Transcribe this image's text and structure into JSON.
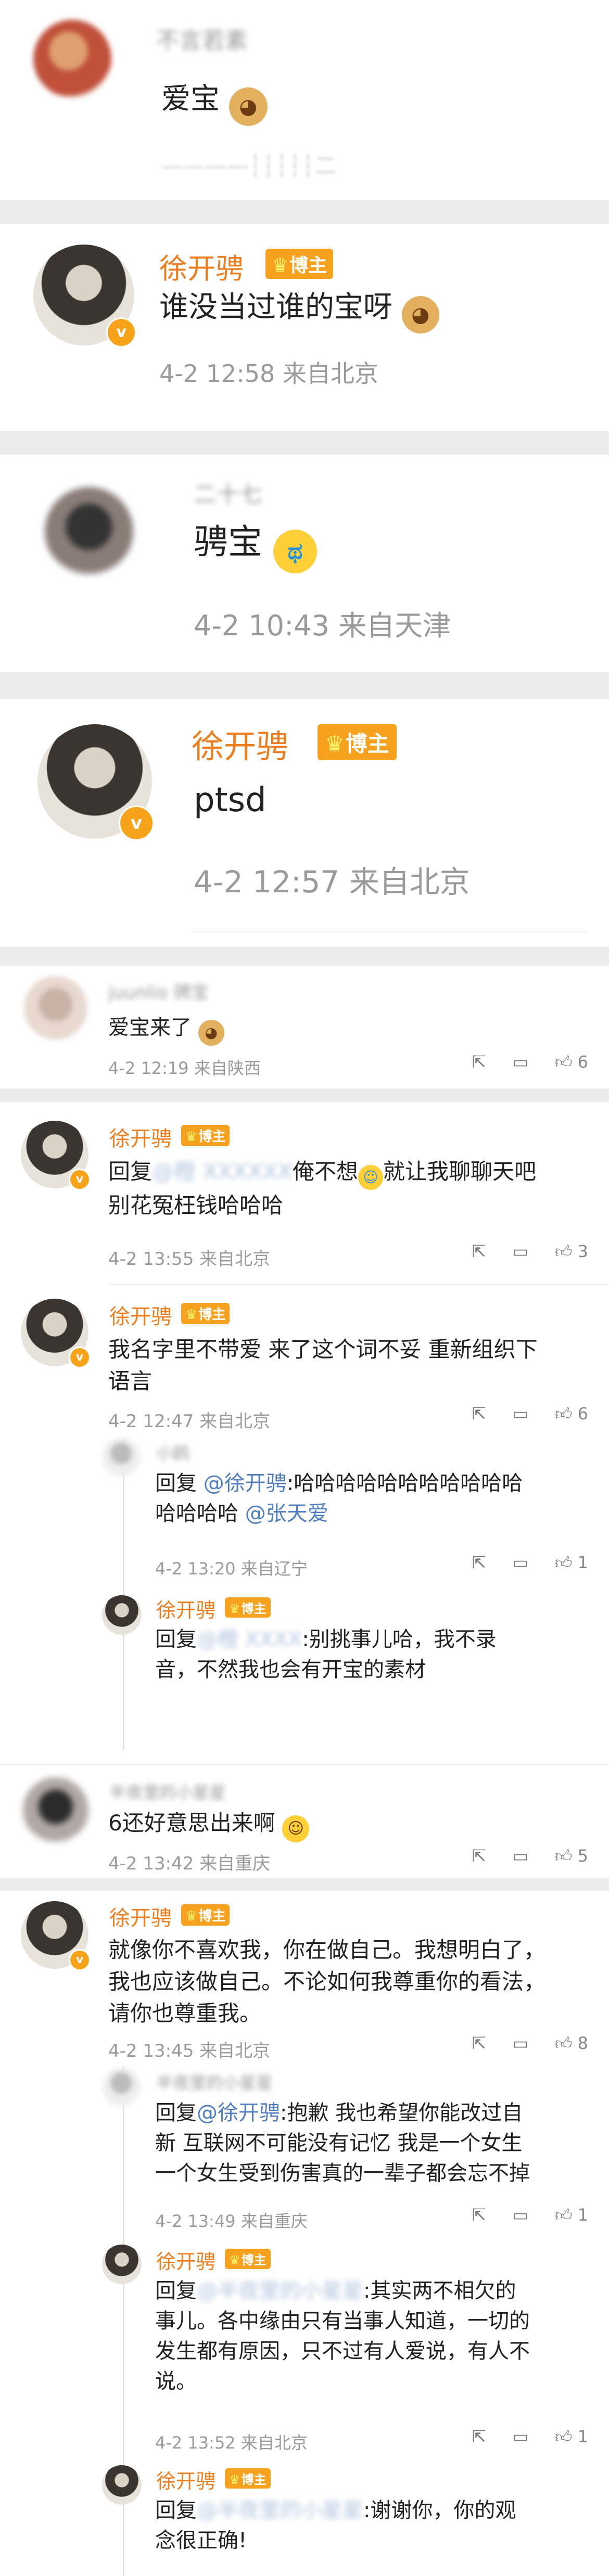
{
  "posts": {
    "p1": {
      "author": "不言若素",
      "text": "爱宝",
      "emoji": "doge-emoji",
      "extra": "————┆┆┆┆┆二"
    },
    "p2": {
      "author": "徐开骋",
      "badge": "博主",
      "text": "谁没当过谁的宝呀",
      "emoji": "doge-emoji",
      "meta": "4-2 12:58  来自北京"
    },
    "p3": {
      "author": "二十七",
      "text": "骋宝",
      "emoji": "cry-emoji",
      "meta": "4-2 10:43  来自天津"
    },
    "p4": {
      "author": "徐开骋",
      "badge": "博主",
      "text": "ptsd",
      "meta": "4-2 12:57  来自北京"
    }
  },
  "comments": {
    "c1": {
      "author": "juunlio 骋宝",
      "text": "爱宝来了",
      "meta": "4-2 12:19  来自陕西",
      "likes": "6"
    },
    "c2": {
      "author": "徐开骋",
      "badge": "博主",
      "reply_prefix": "回复",
      "reply_to_blur": "@橙 XXXXXX",
      "text_a": "俺不想",
      "text_b": "就让我聊聊天吧",
      "text_c": "别花冤枉钱哈哈哈",
      "meta": "4-2 13:55  来自北京",
      "likes": "3"
    },
    "c3": {
      "author": "徐开骋",
      "badge": "博主",
      "line1": "我名字里不带爱 来了这个词不妥 重新组织下",
      "line2": "语言",
      "meta": "4-2 12:47  来自北京",
      "likes": "6"
    },
    "c3r1": {
      "author": "小鸥",
      "reply_prefix": "回复",
      "mention1": "@徐开骋",
      "text1": ":哈哈哈哈哈哈哈哈哈哈哈",
      "line2": "哈哈哈哈",
      "mention2": "@张天爱",
      "meta": "4-2 13:20  来自辽宁",
      "likes": "1"
    },
    "c3r2": {
      "author": "徐开骋",
      "badge": "博主",
      "reply_prefix": "回复",
      "reply_to_blur": "@橙 XXXX",
      "text1": ":别挑事儿哈，我不录",
      "line2": "音，不然我也会有开宝的素材"
    },
    "c4": {
      "author": "半夜里的小星星",
      "text": "6还好意思出来啊",
      "meta": "4-2 13:42  来自重庆",
      "likes": "5"
    },
    "c5": {
      "author": "徐开骋",
      "badge": "博主",
      "line1": "就像你不喜欢我，你在做自己。我想明白了，",
      "line2": "我也应该做自己。不论如何我尊重你的看法，",
      "line3": "请你也尊重我。",
      "meta": "4-2 13:45  来自北京",
      "likes": "8"
    },
    "c5r1": {
      "author": "半夜里的小星星",
      "reply_prefix": "回复",
      "mention": "@徐开骋",
      "text1": ":抱歉 我也希望你能改过自",
      "line2": "新 互联网不可能没有记忆 我是一个女生",
      "line3": "一个女生受到伤害真的一辈子都会忘不掉",
      "meta": "4-2 13:49  来自重庆",
      "likes": "1"
    },
    "c5r2": {
      "author": "徐开骋",
      "badge": "博主",
      "reply_prefix": "回复",
      "reply_to_blur": "@半夜里的小星星",
      "text1": ":其实两不相欠的",
      "line2": "事儿。各中缘由只有当事人知道，一切的",
      "line3": "发生都有原因，只不过有人爱说，有人不",
      "line4": "说。",
      "meta": "4-2 13:52  来自北京",
      "likes": "1"
    },
    "c5r3": {
      "author": "徐开骋",
      "badge": "博主",
      "reply_prefix": "回复",
      "reply_to_blur": "@半夜里的小星星",
      "text1": ":谢谢你，你的观",
      "line2": "念很正确!"
    }
  },
  "colors": {
    "orange": "#f07d1d",
    "badge": "#f6a21f",
    "link": "#4f7dbf",
    "gray": "#9a9a9a"
  }
}
